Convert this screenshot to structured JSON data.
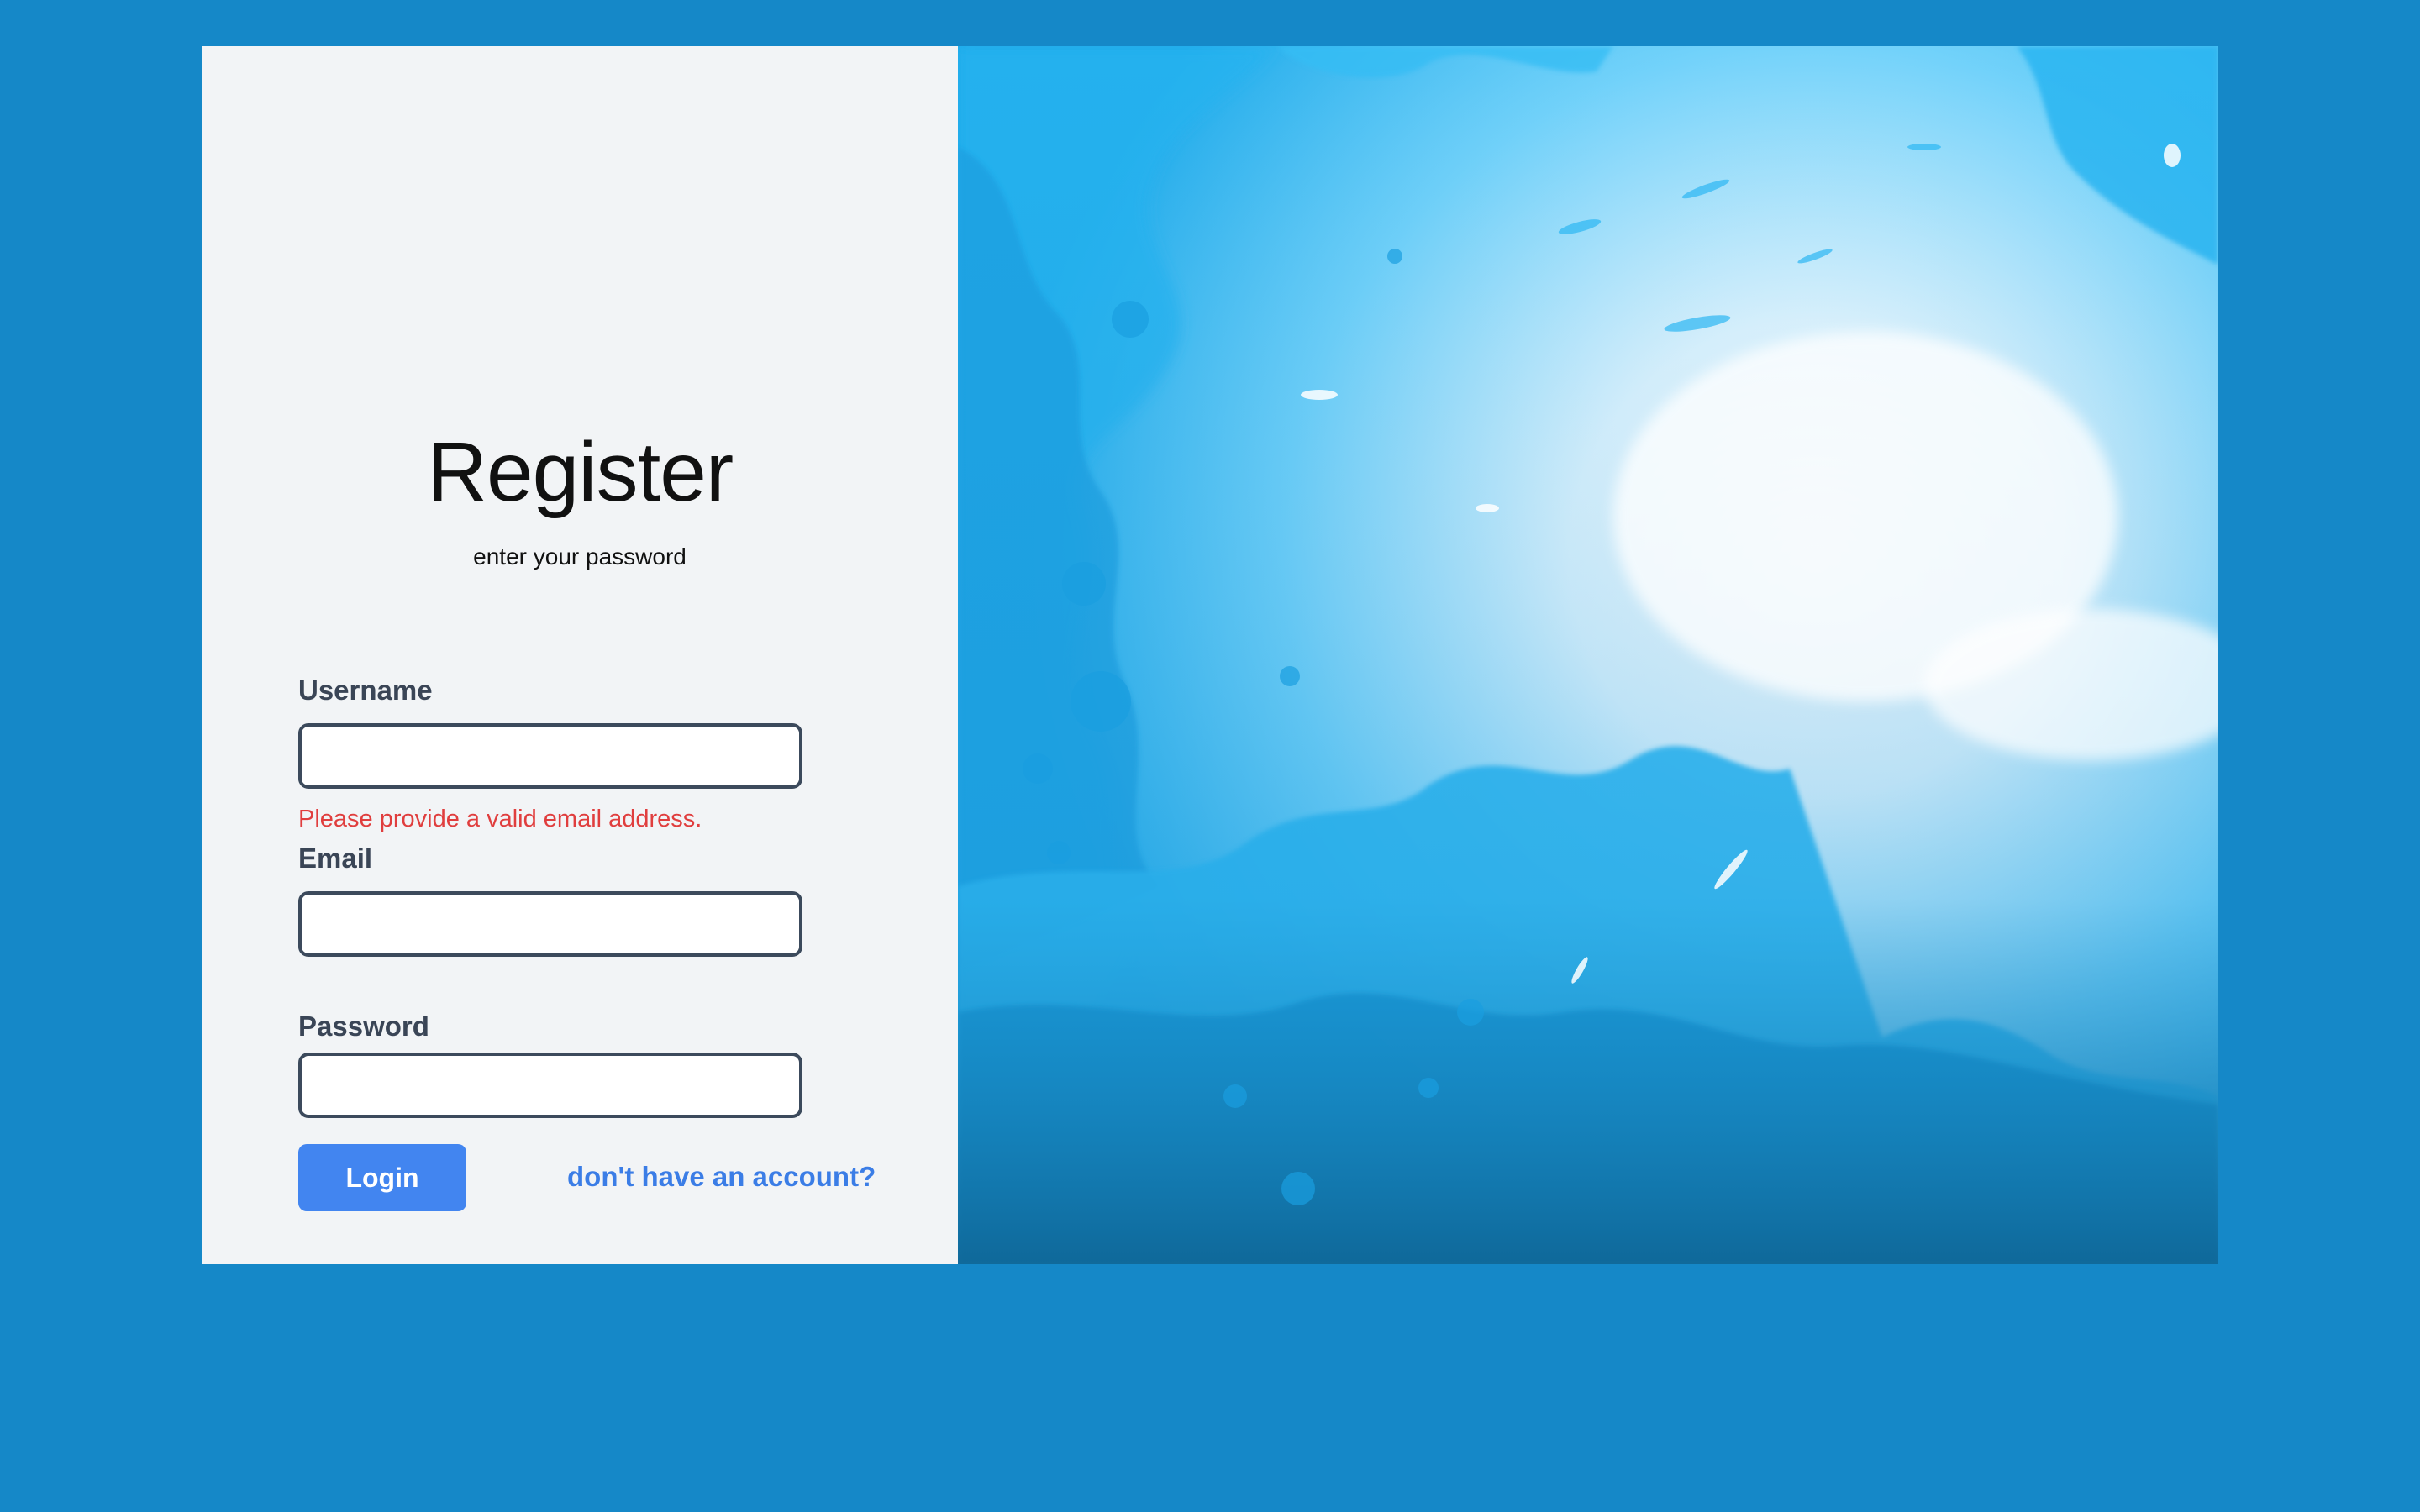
{
  "form": {
    "title": "Register",
    "subtitle": "enter your password",
    "username": {
      "label": "Username",
      "value": "",
      "placeholder": ""
    },
    "error": "Please provide a valid email address.",
    "email": {
      "label": "Email",
      "value": "",
      "placeholder": ""
    },
    "password": {
      "label": "Password",
      "value": "",
      "placeholder": ""
    },
    "login_label": "Login",
    "account_link": "don't have an account?"
  },
  "hero": {
    "image": "blue-watercolor-splash-background"
  },
  "colors": {
    "page_background": "#1588c8",
    "form_background": "#f2f4f6",
    "primary_button": "#4285f0",
    "link": "#3b7de6",
    "error": "#e03e3e"
  }
}
